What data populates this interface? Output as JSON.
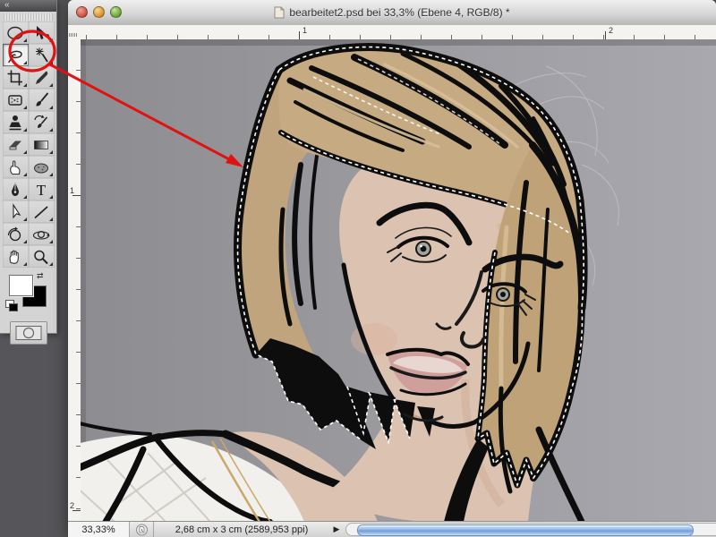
{
  "window": {
    "title": "bearbeitet2.psd bei 33,3% (Ebene 4, RGB/8) *"
  },
  "toolbar": {
    "collapse_glyph": "«",
    "selected_tool": "lasso",
    "tools": [
      "elliptical-marquee",
      "move",
      "lasso",
      "magic-wand",
      "crop",
      "eyedropper",
      "patch",
      "brush",
      "clone-stamp",
      "history-brush",
      "eraser",
      "gradient",
      "smudge",
      "sponge",
      "pen",
      "type",
      "path-selection",
      "line",
      "3d-rotate",
      "3d-orbit",
      "hand",
      "zoom"
    ],
    "foreground_color": "#ffffff",
    "background_color": "#000000"
  },
  "rulers": {
    "horizontal": [
      "1",
      "2"
    ],
    "vertical": [
      "1",
      "2"
    ]
  },
  "statusbar": {
    "zoom_value": "33,33%",
    "doc_info": "2,68 cm x 3 cm (2589,953 ppi)",
    "flyout_glyph": "▶"
  },
  "annotation": {
    "color": "#e01212",
    "highlights": "lasso-tool"
  },
  "canvas": {
    "subject": "comic-style portrait of a woman with blonde bob; hair outlined by marching-ants selection",
    "colors": {
      "background": "#9a9aa0",
      "hair": "#c0a47d",
      "line_art": "#0d0d0d",
      "skin": "#dcc2b0",
      "lips": "#cfa09b",
      "blouse": "#f2f0ec",
      "necklace": "#c8a96b",
      "ants": "#ffffff"
    }
  }
}
